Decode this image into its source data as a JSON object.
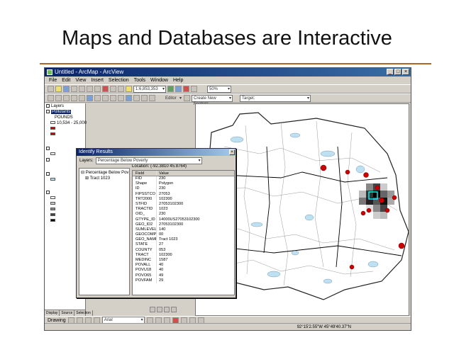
{
  "slide": {
    "title": "Maps and Databases are Interactive"
  },
  "window": {
    "title": "Untitled - ArcMap - ArcView",
    "menus": [
      "File",
      "Edit",
      "View",
      "Insert",
      "Selection",
      "Tools",
      "Window",
      "Help"
    ],
    "map_scale": "1:6,853,353",
    "editor_label": "Editor",
    "task_value": "Create New Feature",
    "target_label": "Target:",
    "zoom_value": "50%",
    "drawing_label": "Drawing",
    "font_value": "Arial",
    "status_coords": "92°15'2.55\"W  45°49'40.37\"N"
  },
  "toc": {
    "root": "Layers",
    "layer_selected": "Pollutants",
    "field": "POUNDS",
    "class_range": "10,534 - 25,000",
    "tabs": [
      "Display",
      "Source",
      "Selection"
    ]
  },
  "identify": {
    "title": "Identify Results",
    "layers_label": "Layers:",
    "layers_value": "Percentage Below Poverty",
    "tree_root": "Percentage Below Pov",
    "tree_child": "Tract 1023",
    "location": "Location: (-92.3810 45.8764)",
    "col_field": "Field",
    "col_value": "Value",
    "rows": [
      {
        "f": "FID",
        "v": "230"
      },
      {
        "f": "Shape",
        "v": "Polygon"
      },
      {
        "f": "ID",
        "v": "230"
      },
      {
        "f": "FIPSSTCO",
        "v": "27053"
      },
      {
        "f": "TRT2000",
        "v": "102300"
      },
      {
        "f": "STFID",
        "v": "27053102300"
      },
      {
        "f": "TRACTID",
        "v": "1023"
      },
      {
        "f": "OID_",
        "v": "230"
      },
      {
        "f": "GTYPE_ID",
        "v": "14000US27053102300"
      },
      {
        "f": "GEO_ID2",
        "v": "27053102300"
      },
      {
        "f": "SUMLEVEL",
        "v": "140"
      },
      {
        "f": "GEOCOMP",
        "v": "00"
      },
      {
        "f": "GEO_NAME",
        "v": "Tract 1023"
      },
      {
        "f": "STATE",
        "v": "27"
      },
      {
        "f": "COUNTY",
        "v": "053"
      },
      {
        "f": "TRACT",
        "v": "102300"
      },
      {
        "f": "MEDINC",
        "v": "1587"
      },
      {
        "f": "POVALL",
        "v": "40"
      },
      {
        "f": "POVU18",
        "v": "40"
      },
      {
        "f": "POVO65",
        "v": "49"
      },
      {
        "f": "POVFAM",
        "v": "29"
      }
    ]
  }
}
